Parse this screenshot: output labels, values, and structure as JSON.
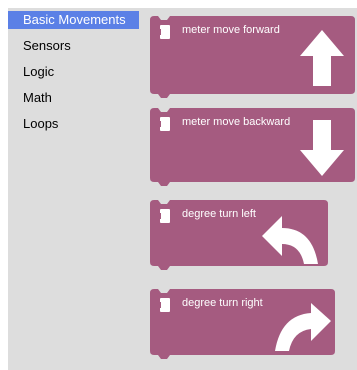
{
  "toolbox": {
    "categories": [
      {
        "label": "Basic Movements",
        "selected": true
      },
      {
        "label": "Sensors",
        "selected": false
      },
      {
        "label": "Logic",
        "selected": false
      },
      {
        "label": "Math",
        "selected": false
      },
      {
        "label": "Loops",
        "selected": false
      }
    ]
  },
  "flyout": {
    "blocks": [
      {
        "label": "meter move forward",
        "icon": "arrow-up-icon"
      },
      {
        "label": "meter move backward",
        "icon": "arrow-down-icon"
      },
      {
        "label": "degree turn left",
        "icon": "turn-left-icon"
      },
      {
        "label": "degree turn right",
        "icon": "turn-right-icon"
      }
    ]
  },
  "colors": {
    "block": "#a55b80",
    "selected_category": "#5b80e6",
    "toolbox_bg": "#dddddd"
  }
}
